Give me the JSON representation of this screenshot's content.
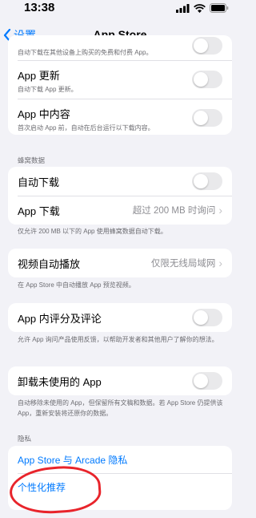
{
  "status": {
    "time": "13:38"
  },
  "nav": {
    "back_label": "设置",
    "title": "App Store"
  },
  "auto_download_section": {
    "partial_row_sub": "自动下载在其他设备上购买的免费和付费 App。",
    "app_updates": {
      "label": "App 更新",
      "sub": "自动下载 App 更新。"
    },
    "in_app_content": {
      "label": "App 中内容",
      "sub": "首次启动 App 前，自动在后台运行以下载内容。"
    }
  },
  "cellular": {
    "header": "蜂窝数据",
    "auto_download_label": "自动下载",
    "app_download_label": "App 下载",
    "app_download_value": "超过 200 MB 时询问",
    "footer": "仅允许 200 MB 以下的 App 使用蜂窝数据自动下载。"
  },
  "video": {
    "label": "视频自动播放",
    "value": "仅限无线局域网",
    "footer": "在 App Store 中自动播放 App 预览视频。"
  },
  "ratings": {
    "label": "App 内评分及评论",
    "footer": "允许 App 询问产品使用反馈，以帮助开发者和其他用户了解你的想法。"
  },
  "offload": {
    "label": "卸载未使用的 App",
    "footer": "自动移除未使用的 App，但保留所有文稿和数据。若 App Store 仍提供该 App，重新安装将还原你的数据。"
  },
  "privacy": {
    "header": "隐私",
    "arcade_privacy_link": "App Store 与 Arcade 隐私",
    "personalized_link": "个性化推荐"
  },
  "toggles": {
    "partial": false,
    "app_updates": false,
    "in_app_content": false,
    "cellular_auto_download": false,
    "ratings": false,
    "offload": false
  },
  "colors": {
    "accent": "#007aff",
    "annotation": "#e8242b"
  }
}
